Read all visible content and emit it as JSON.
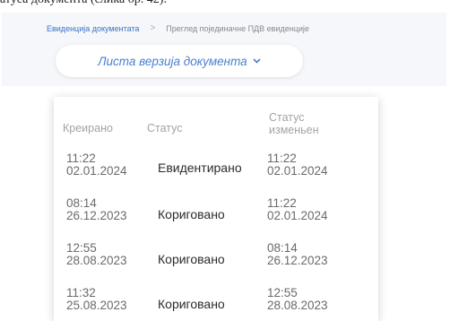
{
  "caption_fragment": "атуса документа (слика бр. 42).",
  "breadcrumb": {
    "items": [
      {
        "label": "Евиденција документата"
      },
      {
        "label": "Преглед појединачне ПДВ евиденције"
      }
    ],
    "separator": ">"
  },
  "version_button": {
    "label": "Листа верзија документа",
    "icon": "chevron-down-icon"
  },
  "version_table": {
    "headers": {
      "created": "Креирано",
      "status": "Статус",
      "status_changed": "Статус изменьен"
    },
    "rows": [
      {
        "created_time": "11:22",
        "created_date": "02.01.2024",
        "status": "Евидентирано",
        "changed_time": "11:22",
        "changed_date": "02.01.2024"
      },
      {
        "created_time": "08:14",
        "created_date": "26.12.2023",
        "status": "Кориговано",
        "changed_time": "11:22",
        "changed_date": "02.01.2024"
      },
      {
        "created_time": "12:55",
        "created_date": "28.08.2023",
        "status": "Кориговано",
        "changed_time": "08:14",
        "changed_date": "26.12.2023"
      },
      {
        "created_time": "11:32",
        "created_date": "25.08.2023",
        "status": "Кориговано",
        "changed_time": "12:55",
        "changed_date": "28.08.2023"
      }
    ]
  },
  "colors": {
    "accent": "#4a7fd0",
    "link": "#3a73c8",
    "header_text": "#a3a3a3",
    "time_text": "#6a6a6a",
    "status_text": "#2b2b2b",
    "toolbar_bg": "#f5f7fa"
  }
}
